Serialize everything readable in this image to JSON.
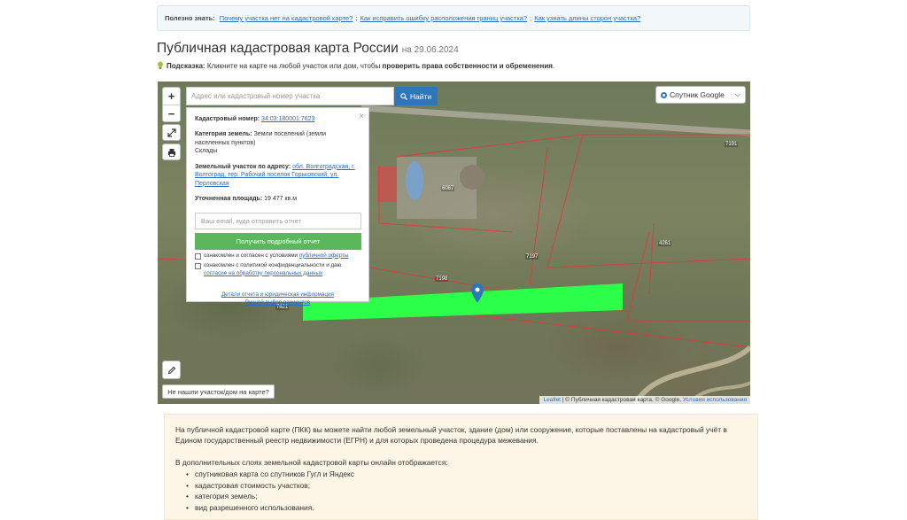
{
  "infobar": {
    "label": "Полезно знать:",
    "links": [
      "Почему участка нет на кадастровой карте?",
      "Как исправить ошибку расположения границ участка?",
      "Как узнать длины сторон участка?"
    ],
    "separator": ";"
  },
  "header": {
    "title": "Публичная кадастровая карта России",
    "date": "на 29.06.2024"
  },
  "hint": {
    "label": "Подсказка:",
    "text": "Кликните на карте на любой участок или дом, чтобы",
    "bold": "проверить права собственности и обременения",
    "end": "."
  },
  "map": {
    "zoom_in": "+",
    "zoom_out": "−",
    "search_placeholder": "Адрес или кадастровый номер участка",
    "find_label": "Найти",
    "layer_label": "Спутник Google",
    "not_found_label": "Не нашли участок/дом на карте?",
    "attribution_leaflet": "Leaflet",
    "attribution_text": "| © Публичная кадастровая карта, © Google,",
    "attribution_terms": "Условия использования",
    "parcel_labels": [
      "7191",
      "6067",
      "4261",
      "7197",
      "7198",
      "7621"
    ]
  },
  "popup": {
    "close": "×",
    "cadastral_label": "Кадастровый номер:",
    "cadastral_value": "34:03:180001:7623",
    "category_label": "Категория земель:",
    "category_value": "Земли поселений (земли населенных пунктов)",
    "use_value": "Склады",
    "address_label": "Земельный участок по адресу:",
    "address_value": "обл. Волгоградская, г. Волгоград, тер. Рабочий поселок Горьковский, ул. Перловская",
    "area_label": "Уточненная площадь:",
    "area_value": "19 477 кв.м",
    "email_placeholder": "Ваш email, куда отправить отчет",
    "get_report": "Получить подробный отчет",
    "check1_text": "ознакомлен и согласен с условиями",
    "check1_link": "публичной оферты",
    "check2_text": "ознакомлен с политикой конфиденциальности и даю",
    "check2_link": "согласие на обработку персональных данных",
    "link1": "Детали отчета и юридическая информация",
    "link2": "Ручной выбор вариантов"
  },
  "info": {
    "para1": "На публичной кадастровой карте (ПКК) вы можете найти любой земельный участок, здание (дом) или сооружение, которые поставлены на кадастровый учёт в Едином государственный реестр недвижимости (ЕГРН) и для которых проведена процедура межевания.",
    "para2": "В дополнительных слоях земельной кадастровой карты онлайн отображается:",
    "items": [
      "спутниковая карта со спутников Гугл и Яндекс",
      "кадастровая стоимость участков;",
      "категория земель;",
      "вид разрешенного использования."
    ]
  },
  "colors": {
    "accent": "#2f76b8",
    "green_button": "#5bb75b",
    "parcel_highlight": "#2bff4a",
    "boundary": "#e0393e"
  }
}
